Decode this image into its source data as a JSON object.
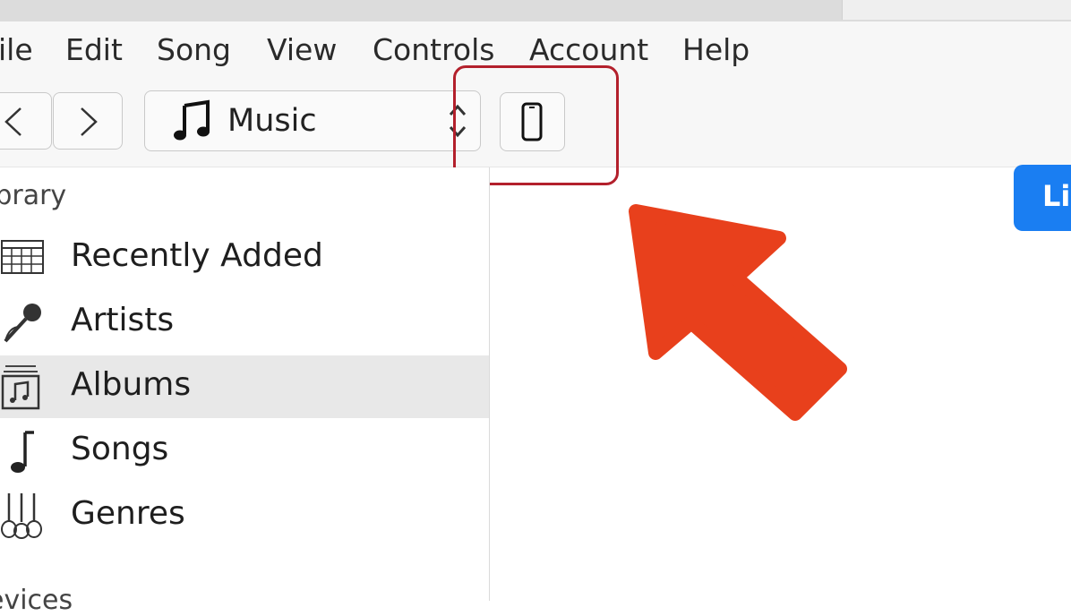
{
  "menu": {
    "file": "ile",
    "edit": "Edit",
    "song": "Song",
    "view": "View",
    "controls": "Controls",
    "account": "Account",
    "help": "Help"
  },
  "toolbar": {
    "media_kind": "Music",
    "library_button": "Li"
  },
  "sidebar": {
    "library_heading": "ibrary",
    "items": [
      {
        "label": "Recently Added",
        "icon": "grid-calendar-icon"
      },
      {
        "label": "Artists",
        "icon": "microphone-icon"
      },
      {
        "label": "Albums",
        "icon": "album-stack-icon",
        "selected": true
      },
      {
        "label": "Songs",
        "icon": "music-note-icon"
      },
      {
        "label": "Genres",
        "icon": "guitars-icon"
      }
    ],
    "devices_heading": "evices"
  },
  "colors": {
    "highlight": "#b3202c",
    "arrow": "#e8401c",
    "accent": "#1a7ef2"
  }
}
